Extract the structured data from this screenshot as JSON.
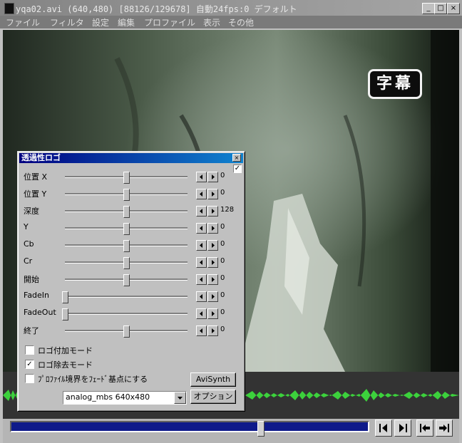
{
  "window": {
    "title": "yqa02.avi (640,480)  [88126/129678]  自動24fps:0  デフォルト",
    "minimize_label": "_",
    "maximize_label": "□",
    "close_label": "×"
  },
  "menu": [
    "ファイル",
    "フィルタ",
    "設定",
    "編集",
    "プロファイル",
    "表示",
    "その他"
  ],
  "video": {
    "overlay_caption": "字幕"
  },
  "dialog": {
    "title": "透過性ロゴ",
    "close_label": "×",
    "enable_check": "✓",
    "sliders": [
      {
        "label": "位置 X",
        "value": "0",
        "position": 0.5
      },
      {
        "label": "位置 Y",
        "value": "0",
        "position": 0.5
      },
      {
        "label": "深度",
        "value": "128",
        "position": 0.5
      },
      {
        "label": "Y",
        "value": "0",
        "position": 0.5
      },
      {
        "label": "Cb",
        "value": "0",
        "position": 0.5
      },
      {
        "label": "Cr",
        "value": "0",
        "position": 0.5
      },
      {
        "label": "開始",
        "value": "0",
        "position": 0.5
      },
      {
        "label": "FadeIn",
        "value": "0",
        "position": 0.0
      },
      {
        "label": "FadeOut",
        "value": "0",
        "position": 0.0
      },
      {
        "label": "終了",
        "value": "0",
        "position": 0.5
      }
    ],
    "checkboxes": [
      {
        "label": "ロゴ付加モード",
        "checked": false
      },
      {
        "label": "ロゴ除去モード",
        "checked": true
      },
      {
        "label": "ﾌﾟﾛﾌｧｲﾙ境界をﾌｪｰﾄﾞ基点にする",
        "checked": false
      }
    ],
    "avisynth_button": "AviSynth",
    "option_button": "オプション",
    "logo_select": "analog_mbs 640x480"
  },
  "seek": {
    "position": 0.69
  },
  "colors": {
    "titlebar": "#8c8c8c",
    "menubar": "#7a7a7a",
    "dialog_title": "#000080",
    "seek_track": "#0e1a8a",
    "waveform": "#3cd13c"
  }
}
